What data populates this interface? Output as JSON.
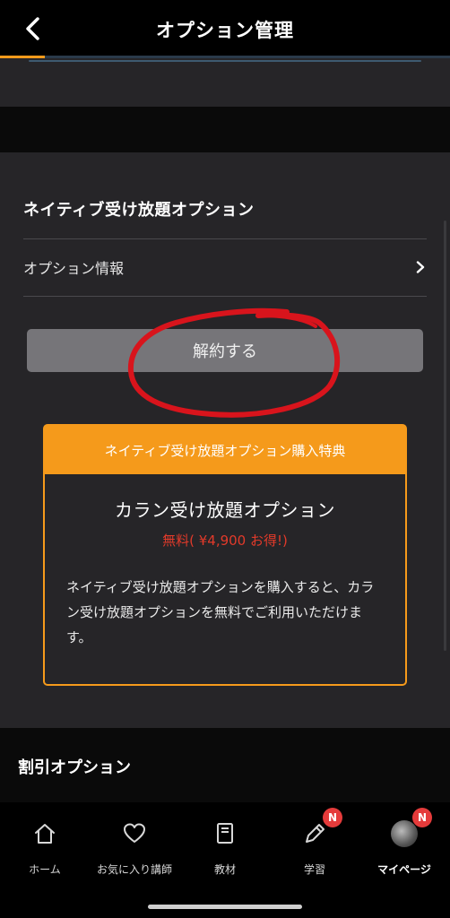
{
  "header": {
    "title": "オプション管理",
    "progress_fraction": 0.1
  },
  "native_option": {
    "section_title": "ネイティブ受け放題オプション",
    "info_row_label": "オプション情報",
    "cancel_label": "解約する"
  },
  "benefit": {
    "heading": "ネイティブ受け放題オプション購入特典",
    "name": "カラン受け放題オプション",
    "price": "無料( ¥4,900 お得!)",
    "description": "ネイティブ受け放題オプションを購入すると、カラン受け放題オプションを無料でご利用いただけます。"
  },
  "discount": {
    "section_title": "割引オプション"
  },
  "tabbar": {
    "items": [
      {
        "label": "ホーム",
        "icon": "home-icon"
      },
      {
        "label": "お気に入り講師",
        "icon": "heart-icon"
      },
      {
        "label": "教材",
        "icon": "book-icon"
      },
      {
        "label": "学習",
        "icon": "pencil-icon",
        "badge": "N"
      },
      {
        "label": "マイページ",
        "icon": "avatar",
        "badge": "N",
        "active": true
      }
    ]
  },
  "colors": {
    "accent": "#f59a1b",
    "price_red": "#e23a2a",
    "badge_red": "#e53b3b",
    "annotation_red": "#d8141c"
  }
}
